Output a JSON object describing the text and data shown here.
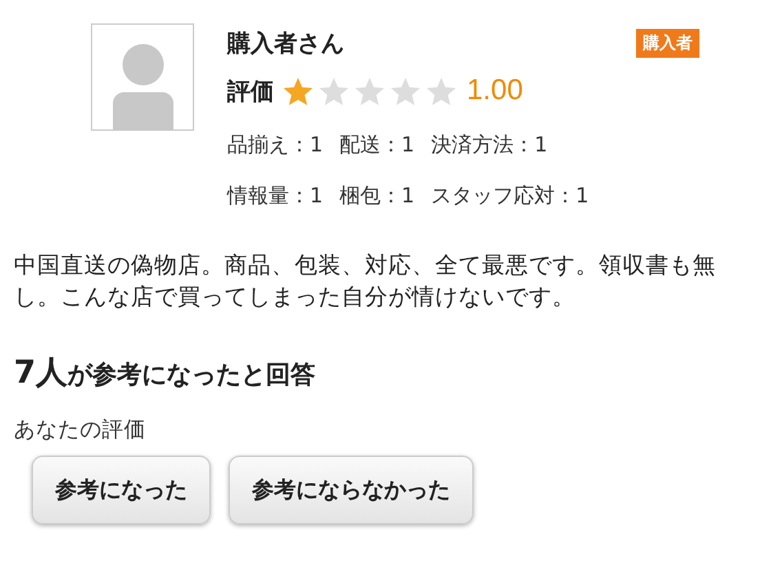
{
  "reviewer": {
    "name": "購入者さん",
    "badge": "購入者"
  },
  "rating": {
    "label": "評価",
    "stars": 1,
    "score": "1.00"
  },
  "criteria_lines": [
    [
      "品揃え：1",
      "配送：1",
      "決済方法：1"
    ],
    [
      "情報量：1",
      "梱包：1",
      "スタッフ応対：1"
    ]
  ],
  "comment": "中国直送の偽物店。商品、包装、対応、全て最悪です。領収書も無し。こんな店で買ってしまった自分が情けないです。",
  "helpful": {
    "count": "7人",
    "text": "が参考になったと回答"
  },
  "your_rating_label": "あなたの評価",
  "buttons": [
    "参考になった",
    "参考にならなかった"
  ]
}
